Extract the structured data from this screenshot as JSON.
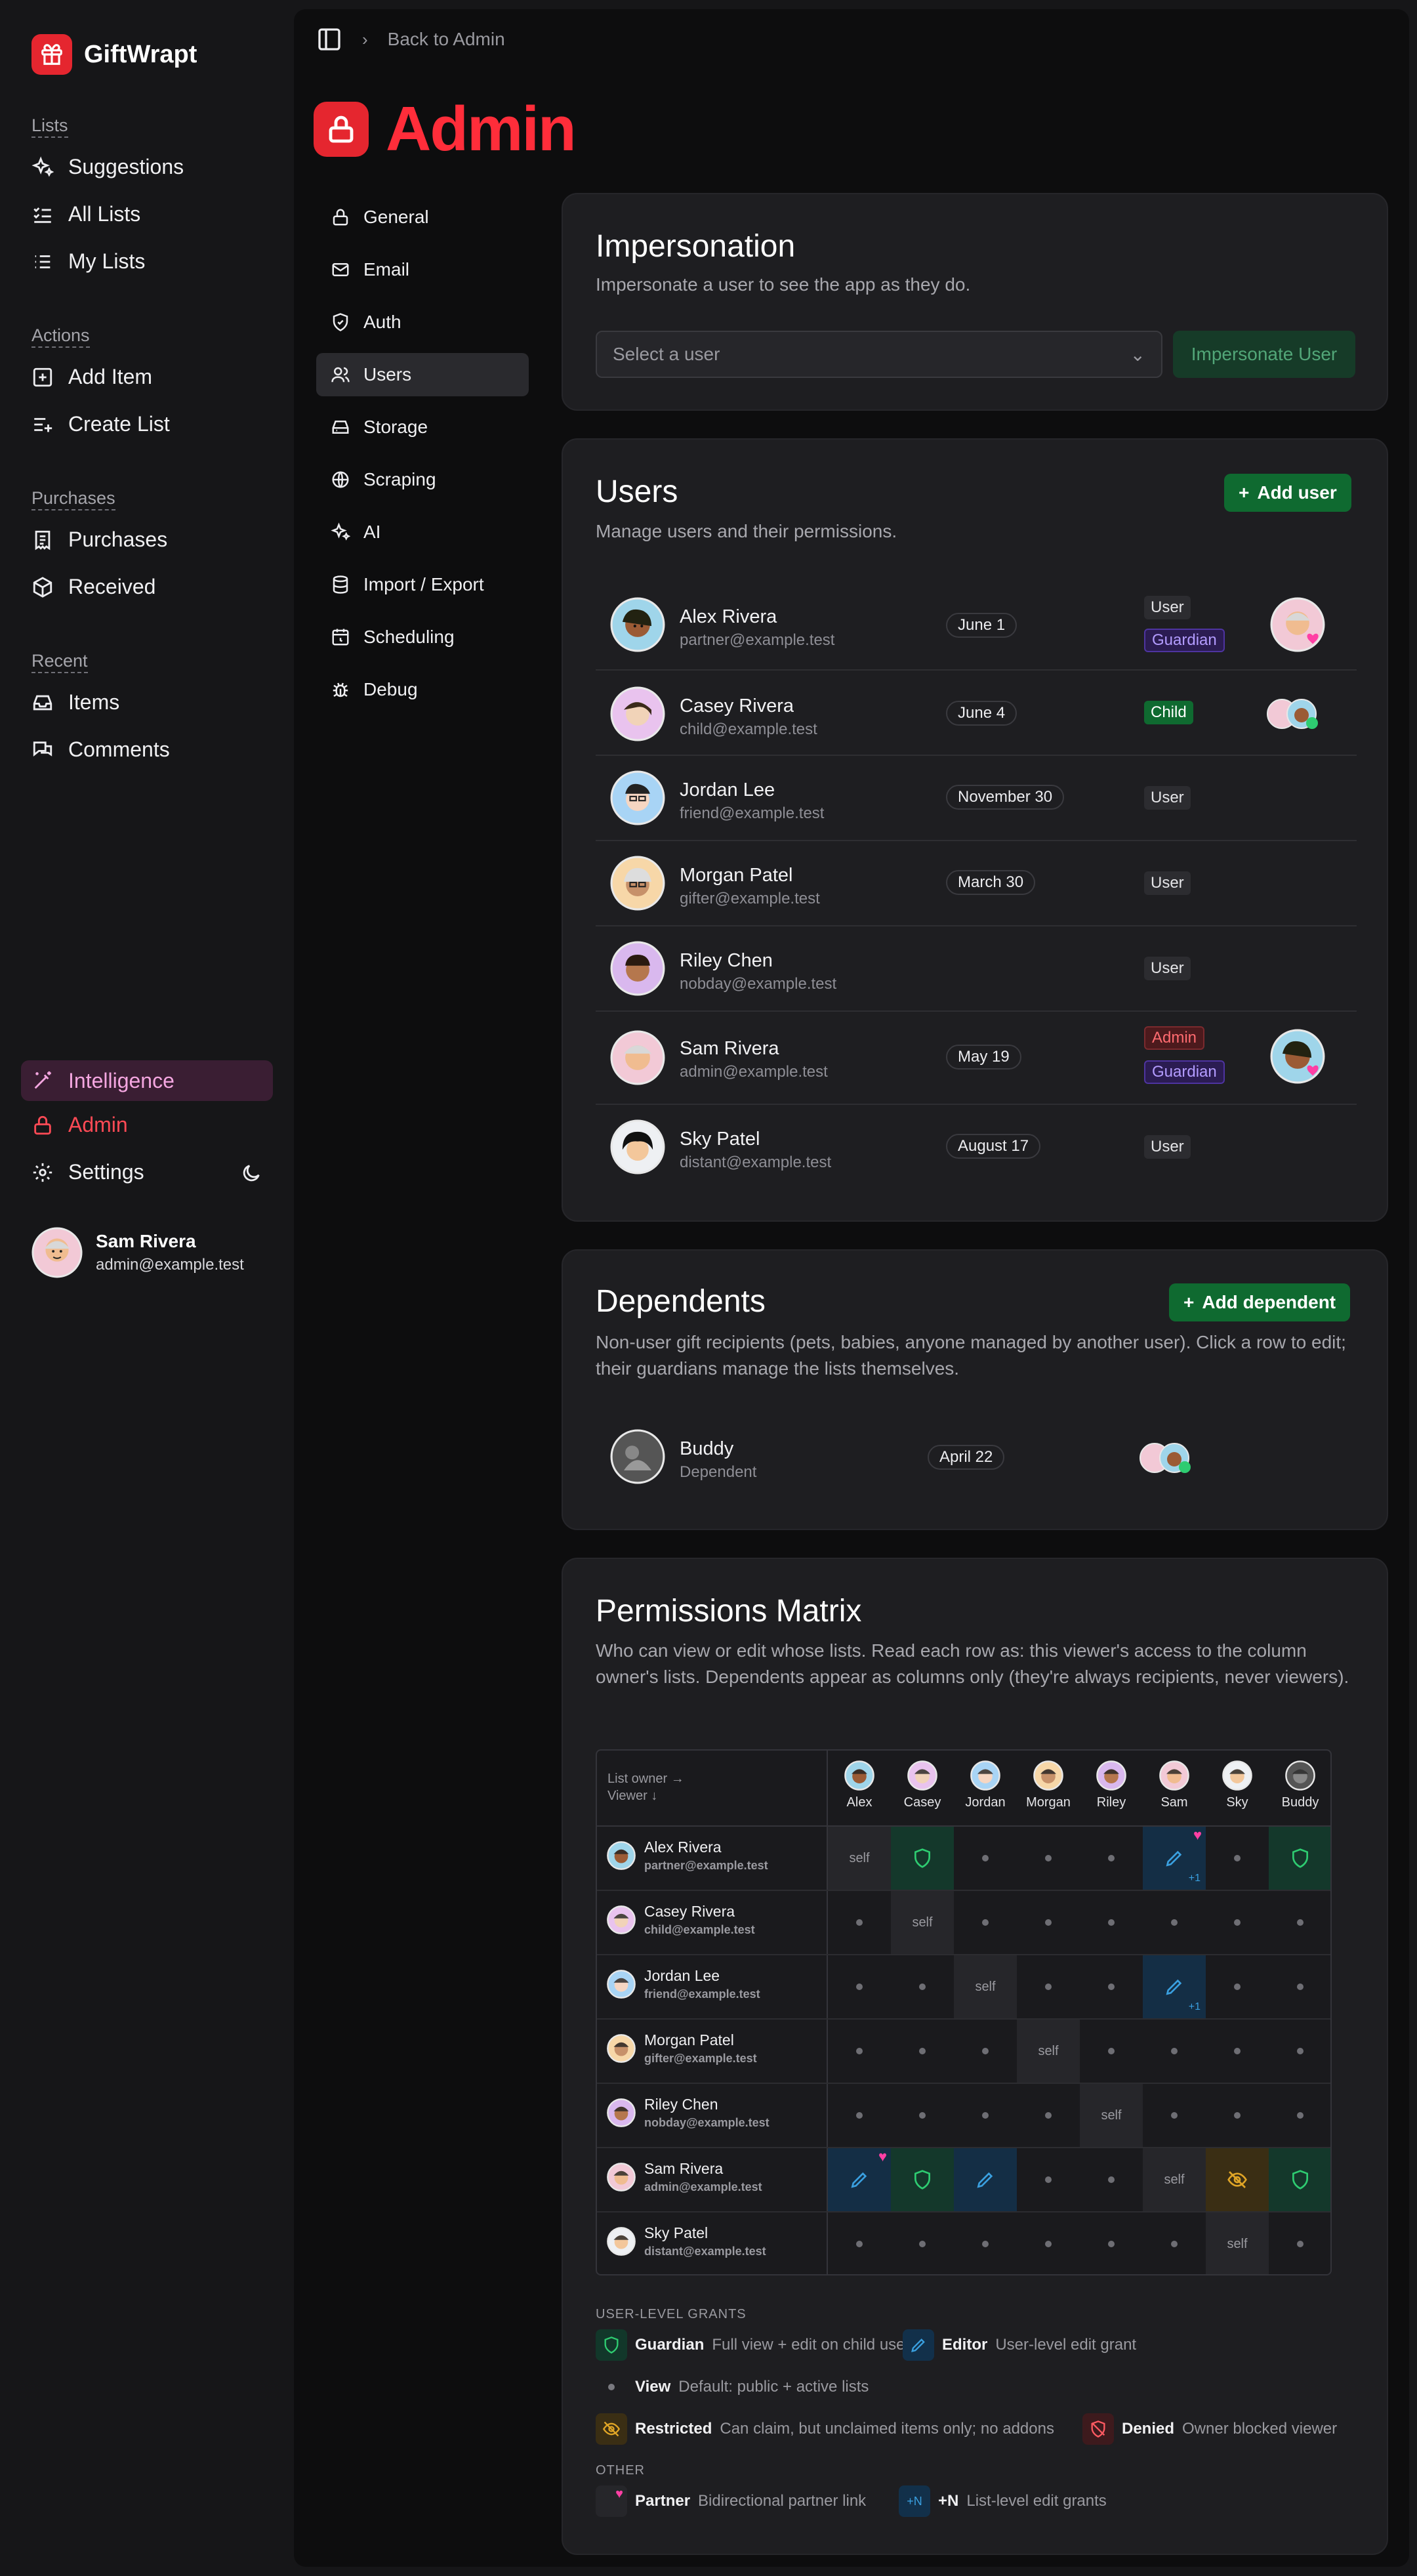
{
  "app": {
    "name": "GiftWrapt"
  },
  "sidebar": {
    "groups": {
      "lists": "Lists",
      "actions": "Actions",
      "purchases": "Purchases",
      "recent": "Recent"
    },
    "items": {
      "suggestions": "Suggestions",
      "all_lists": "All Lists",
      "my_lists": "My Lists",
      "add_item": "Add Item",
      "create_list": "Create List",
      "purchases": "Purchases",
      "received": "Received",
      "items": "Items",
      "comments": "Comments",
      "intelligence": "Intelligence",
      "admin": "Admin",
      "settings": "Settings"
    },
    "user": {
      "name": "Sam Rivera",
      "email": "admin@example.test"
    }
  },
  "topbar": {
    "back": "Back to Admin"
  },
  "page": {
    "title": "Admin"
  },
  "subnav": [
    "General",
    "Email",
    "Auth",
    "Users",
    "Storage",
    "Scraping",
    "AI",
    "Import / Export",
    "Scheduling",
    "Debug"
  ],
  "impersonation": {
    "title": "Impersonation",
    "desc": "Impersonate a user to see the app as they do.",
    "placeholder": "Select a user",
    "button": "Impersonate User"
  },
  "users": {
    "title": "Users",
    "desc": "Manage users and their permissions.",
    "add": "Add user",
    "rows": [
      {
        "name": "Alex Rivera",
        "email": "partner@example.test",
        "date": "June 1",
        "roles": [
          "User",
          "Guardian"
        ]
      },
      {
        "name": "Casey Rivera",
        "email": "child@example.test",
        "date": "June 4",
        "roles": [
          "Child"
        ]
      },
      {
        "name": "Jordan Lee",
        "email": "friend@example.test",
        "date": "November 30",
        "roles": [
          "User"
        ]
      },
      {
        "name": "Morgan Patel",
        "email": "gifter@example.test",
        "date": "March 30",
        "roles": [
          "User"
        ]
      },
      {
        "name": "Riley Chen",
        "email": "nobday@example.test",
        "date": "",
        "roles": [
          "User"
        ]
      },
      {
        "name": "Sam Rivera",
        "email": "admin@example.test",
        "date": "May 19",
        "roles": [
          "Admin",
          "Guardian"
        ]
      },
      {
        "name": "Sky Patel",
        "email": "distant@example.test",
        "date": "August 17",
        "roles": [
          "User"
        ]
      }
    ]
  },
  "dependents": {
    "title": "Dependents",
    "desc": "Non-user gift recipients (pets, babies, anyone managed by another user). Click a row to edit; their guardians manage the lists themselves.",
    "add": "Add dependent",
    "rows": [
      {
        "name": "Buddy",
        "sub": "Dependent",
        "date": "April 22"
      }
    ]
  },
  "matrix": {
    "title": "Permissions Matrix",
    "desc": "Who can view or edit whose lists. Read each row as: this viewer's access to the column owner's lists. Dependents appear as columns only (they're always recipients, never viewers).",
    "corner_top": "List owner →",
    "corner_bottom": "Viewer ↓",
    "columns": [
      "Alex",
      "Casey",
      "Jordan",
      "Morgan",
      "Riley",
      "Sam",
      "Sky",
      "Buddy"
    ],
    "rows": [
      {
        "name": "Alex Rivera",
        "email": "partner@example.test",
        "cells": [
          "self",
          "guardian",
          "view",
          "view",
          "view",
          "editor+1p",
          "view",
          "guardian"
        ]
      },
      {
        "name": "Casey Rivera",
        "email": "child@example.test",
        "cells": [
          "view",
          "self",
          "view",
          "view",
          "view",
          "view",
          "view",
          "view"
        ]
      },
      {
        "name": "Jordan Lee",
        "email": "friend@example.test",
        "cells": [
          "view",
          "view",
          "self",
          "view",
          "view",
          "editor+1",
          "view",
          "view"
        ]
      },
      {
        "name": "Morgan Patel",
        "email": "gifter@example.test",
        "cells": [
          "view",
          "view",
          "view",
          "self",
          "view",
          "view",
          "view",
          "view"
        ]
      },
      {
        "name": "Riley Chen",
        "email": "nobday@example.test",
        "cells": [
          "view",
          "view",
          "view",
          "view",
          "self",
          "view",
          "view",
          "view"
        ]
      },
      {
        "name": "Sam Rivera",
        "email": "admin@example.test",
        "cells": [
          "editorp",
          "guardian",
          "editor",
          "view",
          "view",
          "self",
          "restricted",
          "guardian"
        ]
      },
      {
        "name": "Sky Patel",
        "email": "distant@example.test",
        "cells": [
          "view",
          "view",
          "view",
          "view",
          "view",
          "view",
          "self",
          "view"
        ]
      }
    ],
    "self_label": "self",
    "plus_label": "+1",
    "legend": {
      "user_level": "USER-LEVEL GRANTS",
      "guardian": {
        "label": "Guardian",
        "desc": "Full view + edit on child user"
      },
      "editor": {
        "label": "Editor",
        "desc": "User-level edit grant"
      },
      "view": {
        "label": "View",
        "desc": "Default: public + active lists"
      },
      "restricted": {
        "label": "Restricted",
        "desc": "Can claim, but unclaimed items only; no addons"
      },
      "denied": {
        "label": "Denied",
        "desc": "Owner blocked viewer"
      },
      "other": "OTHER",
      "partner": {
        "label": "Partner",
        "desc": "Bidirectional partner link"
      },
      "plusn": {
        "label": "+N",
        "desc": "List-level edit grants",
        "icon": "+N"
      }
    }
  },
  "colors": {
    "accent": "#e5262f",
    "green": "#0f6a30",
    "guardian": "#2ecc71",
    "editor": "#3aa0e0",
    "partner": "#ff3fa4"
  }
}
